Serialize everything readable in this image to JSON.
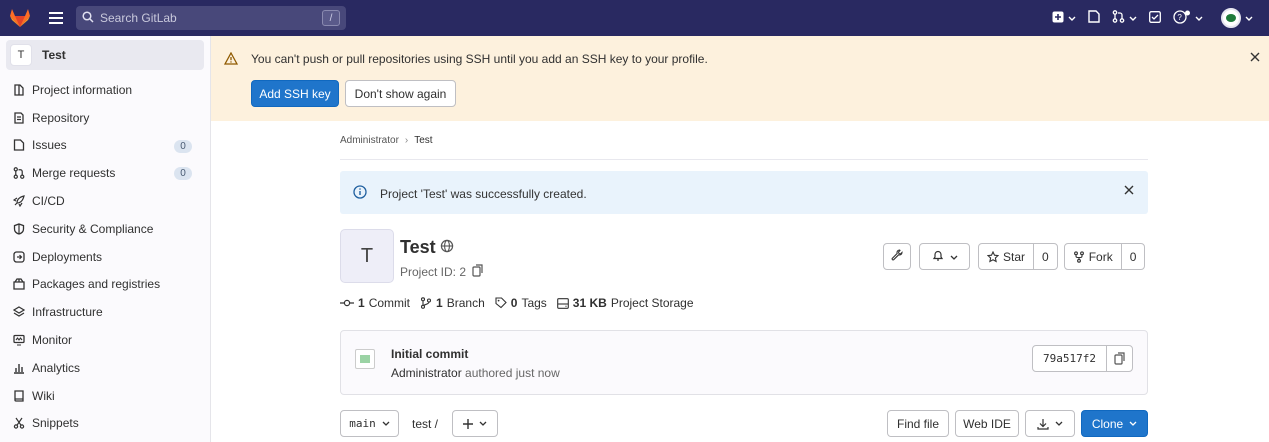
{
  "topbar": {
    "search_placeholder": "Search GitLab",
    "search_shortcut": "/",
    "icons": [
      "gitlab-logo-icon",
      "hamburger-icon",
      "search-icon",
      "plus-square-icon",
      "issues-icon",
      "merge-request-icon",
      "todo-icon",
      "help-icon",
      "avatar"
    ]
  },
  "sidebar": {
    "project_letter": "T",
    "project_name": "Test",
    "items": [
      {
        "label": "Project information",
        "icon": "project-info-icon"
      },
      {
        "label": "Repository",
        "icon": "repository-icon"
      },
      {
        "label": "Issues",
        "icon": "issues-icon",
        "count": "0"
      },
      {
        "label": "Merge requests",
        "icon": "merge-request-icon",
        "count": "0"
      },
      {
        "label": "CI/CD",
        "icon": "rocket-icon"
      },
      {
        "label": "Security & Compliance",
        "icon": "shield-icon"
      },
      {
        "label": "Deployments",
        "icon": "deployments-icon"
      },
      {
        "label": "Packages and registries",
        "icon": "package-icon"
      },
      {
        "label": "Infrastructure",
        "icon": "infrastructure-icon"
      },
      {
        "label": "Monitor",
        "icon": "monitor-icon"
      },
      {
        "label": "Analytics",
        "icon": "analytics-icon"
      },
      {
        "label": "Wiki",
        "icon": "book-icon"
      },
      {
        "label": "Snippets",
        "icon": "snippet-icon"
      }
    ]
  },
  "ssh_alert": {
    "message": "You can't push or pull repositories using SSH until you add an SSH key to your profile.",
    "primary_label": "Add SSH key",
    "secondary_label": "Don't show again"
  },
  "breadcrumb": {
    "parent": "Administrator",
    "current": "Test"
  },
  "info_alert": {
    "message": "Project 'Test' was successfully created."
  },
  "project": {
    "letter": "T",
    "name": "Test",
    "id_text": "Project ID: 2",
    "star_label": "Star",
    "star_count": "0",
    "fork_label": "Fork",
    "fork_count": "0"
  },
  "stats": {
    "commits_num": "1",
    "commits_label": "Commit",
    "branches_num": "1",
    "branches_label": "Branch",
    "tags_num": "0",
    "tags_label": "Tags",
    "storage_num": "31 KB",
    "storage_label": "Project Storage"
  },
  "commit": {
    "title": "Initial commit",
    "author": "Administrator",
    "meta_suffix": "authored just now",
    "sha": "79a517f2"
  },
  "repo_bar": {
    "branch": "main",
    "path": "test /",
    "find_file": "Find file",
    "web_ide": "Web IDE",
    "clone": "Clone"
  },
  "colors": {
    "topbar": "#292961",
    "primary": "#1f75cb",
    "warning_bg": "#fdf1dd",
    "info_bg": "#e9f3fc"
  }
}
